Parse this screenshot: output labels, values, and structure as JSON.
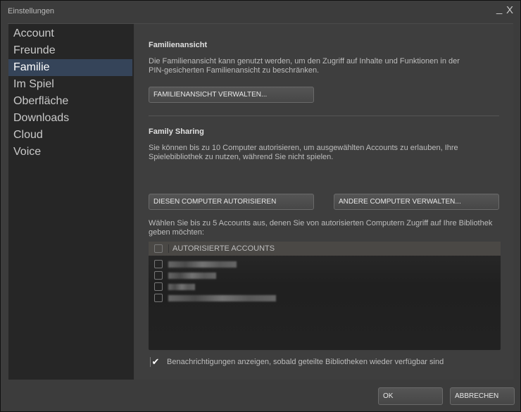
{
  "window": {
    "title": "Einstellungen",
    "minimize": "_",
    "close": "X"
  },
  "sidebar": {
    "items": [
      {
        "label": "Account"
      },
      {
        "label": "Freunde"
      },
      {
        "label": "Familie",
        "selected": true
      },
      {
        "label": "Im Spiel"
      },
      {
        "label": "Oberfläche"
      },
      {
        "label": "Downloads"
      },
      {
        "label": "Cloud"
      },
      {
        "label": "Voice"
      }
    ]
  },
  "family_view": {
    "heading": "Familienansicht",
    "description": "Die Familienansicht kann genutzt werden, um den Zugriff auf Inhalte und Funktionen in der PIN-gesicherten Familienansicht zu beschränken.",
    "manage_button": "FAMILIENANSICHT VERWALTEN..."
  },
  "family_sharing": {
    "heading": "Family Sharing",
    "description": "Sie können bis zu 10 Computer autorisieren, um ausgewählten Accounts zu erlauben, Ihre Spielebibliothek zu nutzen, während Sie nicht spielen.",
    "authorize_button": "DIESEN COMPUTER AUTORISIEREN",
    "manage_button": "ANDERE COMPUTER VERWALTEN...",
    "accounts_hint": "Wählen Sie bis zu 5 Accounts aus, denen Sie von autorisierten Computern Zugriff auf Ihre Bibliothek geben möchten:",
    "table_header": "AUTORISIERTE ACCOUNTS",
    "notify_label": "Benachrichtigungen anzeigen, sobald geteilte Bibliotheken wieder verfügbar sind",
    "notify_checked": true
  },
  "footer": {
    "ok": "OK",
    "cancel": "ABBRECHEN"
  }
}
